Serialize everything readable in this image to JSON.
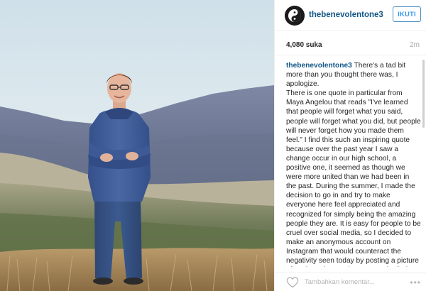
{
  "post": {
    "username": "thebenevolentone3",
    "follow_label": "IKUTI",
    "likes": "4,080 suka",
    "time": "2m",
    "caption_user": "thebenevolentone3",
    "caption_text": "There's a tad bit more than you thought there was, I apologize.\nThere is one quote in particular from Maya Angelou that reads \"I've learned that people will forget what you said, people will forget what you did, but people will never forget how you made them feel.\" I find this such an inspiring quote because over the past year I saw a change occur in our high school, a positive one, it seemed as though we were more united than we had been in the past. During the summer, I made the decision to go in and try to make everyone here feel appreciated and recognized for simply being the amazing people they are. It is easy for people to be cruel over social media, so I decided to make an anonymous account on Instagram that would counteract the negativity seen today by posting a picture of each student and a paragraph of what makes them GREAT and how",
    "comment_placeholder": "Tambahkan komentar...",
    "more_label": "•••"
  },
  "colors": {
    "username": "#125688",
    "follow_border": "#4a90c4",
    "follow_text": "#3897f0",
    "divider": "#efefef"
  },
  "icons": {
    "avatar": "yin-yang-avatar",
    "heart": "heart-outline-icon",
    "more": "more-options-icon"
  }
}
